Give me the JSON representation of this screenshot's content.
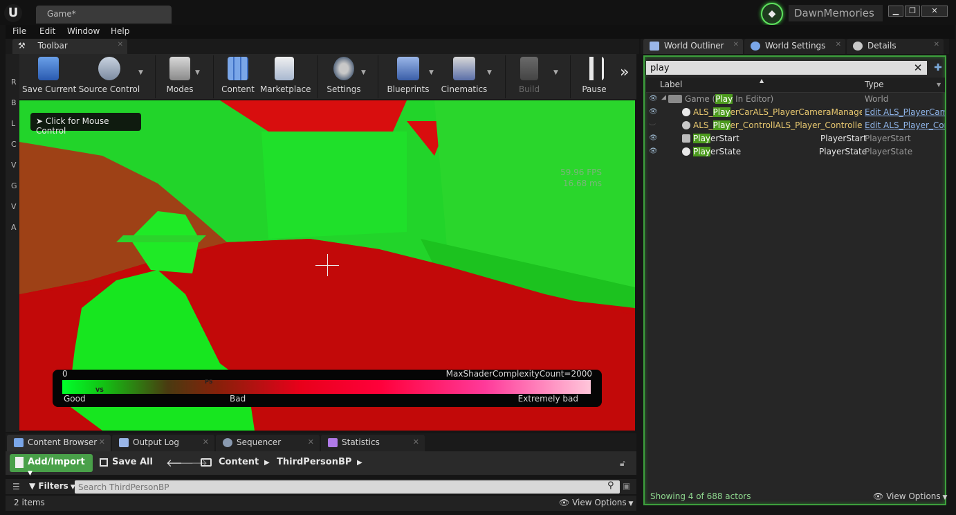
{
  "window": {
    "doc_tab": "Game*",
    "project_name": "DawnMemories",
    "min_glyph": "▁",
    "max_glyph": "❐",
    "close_glyph": "✕"
  },
  "menu": [
    "File",
    "Edit",
    "Window",
    "Help"
  ],
  "toolbar_tab": "Toolbar",
  "left_strip_letters": [
    "R",
    "B",
    "L",
    "C",
    "V",
    "G",
    "V",
    "A"
  ],
  "toolbar": {
    "save_current": "Save Current",
    "source_control": "Source Control",
    "modes": "Modes",
    "content": "Content",
    "marketplace": "Marketplace",
    "settings": "Settings",
    "blueprints": "Blueprints",
    "cinematics": "Cinematics",
    "build": "Build",
    "pause": "Pause",
    "more": "»"
  },
  "viewport": {
    "mouse_hint": "Click for Mouse Control",
    "fps": "59.96 FPS",
    "ms": "16.68 ms",
    "legend": {
      "min": "0",
      "max_label": "MaxShaderComplexityCount=2000",
      "good": "Good",
      "bad": "Bad",
      "extremely_bad": "Extremely bad",
      "vs_mark": "VS",
      "ps_mark": "PS"
    }
  },
  "bottom_tabs": [
    "Content Browser",
    "Output Log",
    "Sequencer",
    "Statistics"
  ],
  "content_browser": {
    "add_import": "Add/Import",
    "save_all": "Save All",
    "crumbs": [
      "Content",
      "ThirdPersonBP"
    ],
    "filters": "Filters",
    "search_placeholder": "Search ThirdPersonBP",
    "items_count": "2 items",
    "view_options": "View Options"
  },
  "right_tabs": [
    "World Outliner",
    "World Settings",
    "Details"
  ],
  "outliner": {
    "search_value": "play",
    "col_label": "Label",
    "col_type": "Type",
    "rows": [
      {
        "pre": "Game (",
        "hl": "Play",
        "post": " In Editor)",
        "type": "World"
      },
      {
        "pre": "ALS_",
        "hl": "Play",
        "post": "erCarALS_PlayerCameraManager_C",
        "type": "Edit ALS_PlayerCam"
      },
      {
        "pre": "ALS_",
        "hl": "Play",
        "post": "er_ControllALS_Player_Controller_C",
        "type": "Edit ALS_Player_Con"
      },
      {
        "pre": "",
        "hl": "Play",
        "post": "erStart",
        "mid": "PlayerStart",
        "type": "PlayerStart"
      },
      {
        "pre": "",
        "hl": "Play",
        "post": "erState",
        "mid": "PlayerState",
        "type": "PlayerState"
      }
    ],
    "actor_count": "Showing 4 of 688 actors",
    "view_options": "View Options"
  },
  "colors": {
    "accent_green": "#3da03d",
    "highlight": "#4c9a1e",
    "link_blue": "#8fb4e8"
  }
}
